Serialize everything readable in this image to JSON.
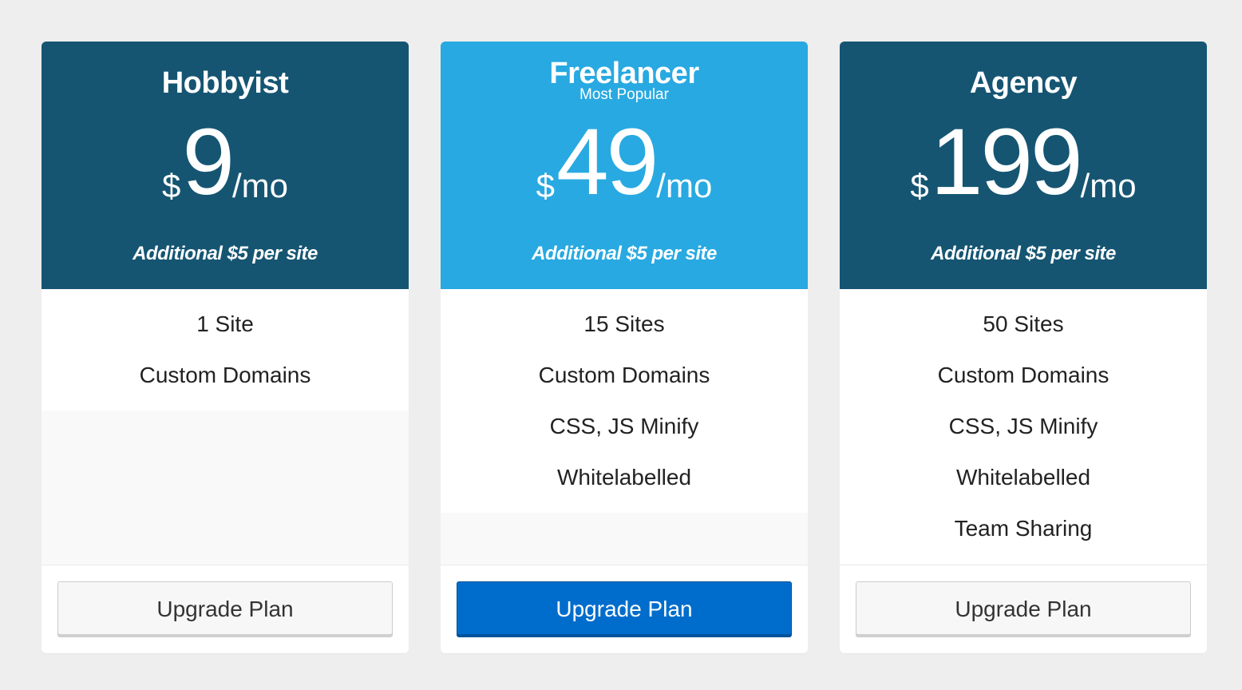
{
  "colors": {
    "page_background": "#eeeeee",
    "standard_header": "#155572",
    "featured_header": "#28a9e1",
    "primary_button": "#006dcc",
    "default_button": "#f7f7f7"
  },
  "plans": [
    {
      "name": "Hobbyist",
      "badge": "",
      "price": {
        "currency": "$",
        "amount": "9",
        "period": "/mo"
      },
      "note": "Additional $5 per site",
      "features": [
        "1 Site",
        "Custom Domains"
      ],
      "button_label": "Upgrade Plan"
    },
    {
      "name": "Freelancer",
      "badge": "Most Popular",
      "price": {
        "currency": "$",
        "amount": "49",
        "period": "/mo"
      },
      "note": "Additional $5 per site",
      "features": [
        "15 Sites",
        "Custom Domains",
        "CSS, JS Minify",
        "Whitelabelled"
      ],
      "button_label": "Upgrade Plan"
    },
    {
      "name": "Agency",
      "badge": "",
      "price": {
        "currency": "$",
        "amount": "199",
        "period": "/mo"
      },
      "note": "Additional $5 per site",
      "features": [
        "50 Sites",
        "Custom Domains",
        "CSS, JS Minify",
        "Whitelabelled",
        "Team Sharing"
      ],
      "button_label": "Upgrade Plan"
    }
  ]
}
